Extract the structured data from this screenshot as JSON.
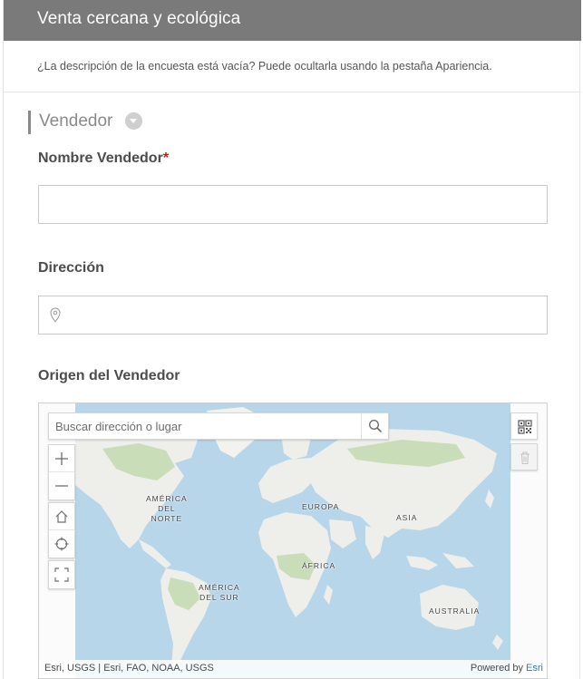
{
  "header": {
    "title": "Venta cercana y ecológica"
  },
  "description": "¿La descripción de la encuesta está vacía? Puede ocultarla usando la pestaña Apariencia.",
  "group": {
    "title": "Vendedor"
  },
  "fields": {
    "name": {
      "label": "Nombre Vendedor",
      "required_mark": "*",
      "value": ""
    },
    "address": {
      "label": "Dirección",
      "value": ""
    },
    "origin": {
      "label": "Origen del Vendedor"
    }
  },
  "map": {
    "search_placeholder": "Buscar dirección o lugar",
    "labels": {
      "north_america": "AMÉRICA DEL NORTE",
      "north_america_l1": "AMÉRICA",
      "north_america_l2": "DEL",
      "north_america_l3": "NORTE",
      "south_america_l1": "AMÉRICA",
      "south_america_l2": "DEL SUR",
      "europe": "EUROPA",
      "asia": "ASIA",
      "africa": "ÁFRICA",
      "australia": "AUSTRALIA"
    },
    "attribution_left": "Esri, USGS | Esri, FAO, NOAA, USGS",
    "powered_by": "Powered by",
    "powered_link": "Esri"
  },
  "icons": {
    "location_pin": "location-pin-icon",
    "search": "search-icon",
    "zoom_in": "plus-icon",
    "zoom_out": "minus-icon",
    "home": "home-icon",
    "locate": "crosshair-icon",
    "fullscreen": "fullscreen-icon",
    "qr": "qr-code-icon",
    "trash": "trash-icon"
  },
  "colors": {
    "header_bg": "#7a7a7a",
    "ocean": "#b7d6ea",
    "land": "#eeeeea",
    "forest": "#c8ddb8",
    "required": "#a82b1e",
    "link": "#2b79c2"
  }
}
